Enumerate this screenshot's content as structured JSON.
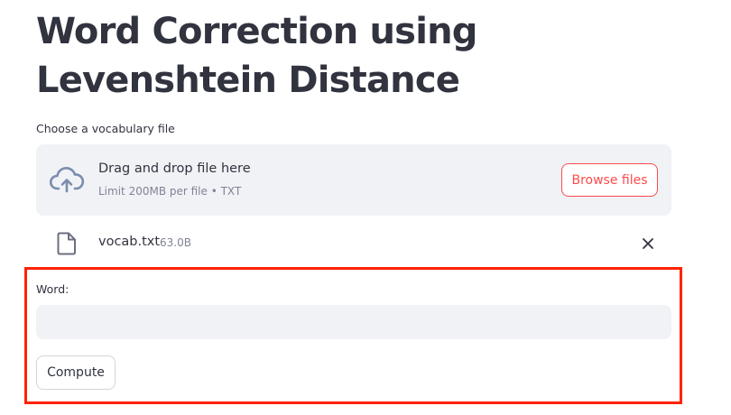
{
  "page": {
    "title": "Word Correction using Levenshtein Distance"
  },
  "uploader": {
    "label": "Choose a vocabulary file",
    "drop_title": "Drag and drop file here",
    "drop_limits": "Limit 200MB per file • TXT",
    "browse_label": "Browse files",
    "icon": "cloud-upload-icon"
  },
  "uploaded_file": {
    "name": "vocab.txt",
    "size": "63.0B",
    "icon": "file-icon",
    "remove_icon": "close-icon"
  },
  "word_form": {
    "label": "Word:",
    "value": "",
    "placeholder": "",
    "compute_label": "Compute"
  },
  "colors": {
    "accent": "#ff4b4b",
    "highlight_border": "#ff2200",
    "input_bg": "#f0f2f6",
    "text": "#31333f",
    "muted": "#808495"
  }
}
